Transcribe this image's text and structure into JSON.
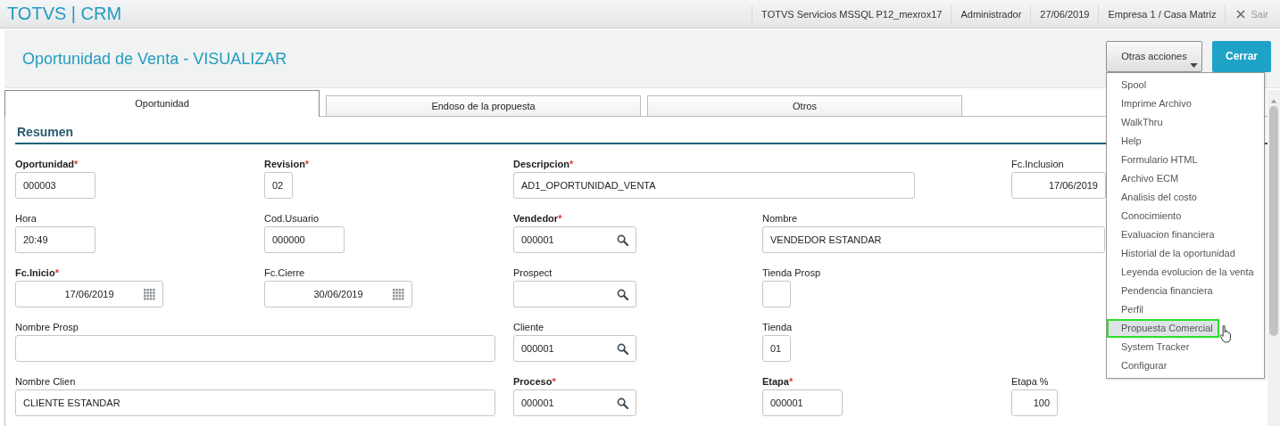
{
  "app": {
    "logo": "TOTVS | CRM",
    "session": [
      "TOTVS Servicios MSSQL P12_mexrox17",
      "Administrador",
      "27/06/2019",
      "Empresa 1 / Casa Matriz"
    ],
    "logout": "Sair"
  },
  "page": {
    "title": "Oportunidad de Venta - VISUALIZAR",
    "actions_button": "Otras acciones",
    "close_button": "Cerrar"
  },
  "tabs": [
    {
      "label": "Oportunidad",
      "selected": true
    },
    {
      "label": "Endoso de la propuesta",
      "selected": false
    },
    {
      "label": "Otros",
      "selected": false
    }
  ],
  "section": {
    "title": "Resumen"
  },
  "form": {
    "rows": [
      [
        {
          "label": "Oportunidad",
          "required": true,
          "mark": "*",
          "value": "000003",
          "kind": "text"
        },
        {
          "label": "Revision",
          "required": true,
          "mark": "*",
          "value": "02",
          "kind": "text"
        },
        {
          "label": "Descripcion",
          "required": true,
          "mark": "*",
          "value": "AD1_OPORTUNIDAD_VENTA",
          "kind": "text"
        },
        {
          "label": "Fc.Inclusion",
          "required": false,
          "value": "17/06/2019",
          "kind": "number"
        }
      ],
      [
        {
          "label": "Hora",
          "required": false,
          "value": "20:49",
          "kind": "text"
        },
        {
          "label": "Cod.Usuario",
          "required": false,
          "value": "000000",
          "kind": "text"
        },
        {
          "label": "Vendedor",
          "required": true,
          "mark": "*",
          "value": "000001",
          "kind": "lookup"
        },
        {
          "label": "Nombre",
          "required": false,
          "value": "VENDEDOR ESTANDAR",
          "kind": "text"
        }
      ],
      [
        {
          "label": "Fc.Inicio",
          "required": true,
          "mark": "*",
          "value": "17/06/2019",
          "kind": "date"
        },
        {
          "label": "Fc.Cierre",
          "required": false,
          "value": "30/06/2019",
          "kind": "date"
        },
        {
          "label": "Prospect",
          "required": false,
          "kind": "lookup"
        },
        {
          "label": "Tienda Prosp",
          "required": false,
          "kind": "text"
        }
      ],
      [
        {
          "label": "Nombre Prosp",
          "required": false,
          "kind": "text"
        },
        {
          "label": "Cliente",
          "required": false,
          "value": "000001",
          "kind": "lookup"
        },
        {
          "label": "Tienda",
          "required": false,
          "value": "01",
          "kind": "text"
        }
      ],
      [
        {
          "label": "Nombre Clien",
          "required": false,
          "value": "CLIENTE ESTANDAR",
          "kind": "text"
        },
        {
          "label": "Proceso",
          "required": true,
          "mark": "*",
          "value": "000001",
          "kind": "lookup"
        },
        {
          "label": "Etapa",
          "required": true,
          "mark": "*",
          "value": "000001",
          "kind": "text"
        },
        {
          "label": "Etapa %",
          "required": false,
          "value": "100",
          "kind": "number"
        }
      ]
    ]
  },
  "actions_menu": {
    "items": [
      {
        "label": "Spool",
        "selected": false
      },
      {
        "label": "Imprime Archivo",
        "selected": false
      },
      {
        "label": "WalkThru",
        "selected": false
      },
      {
        "label": "Help",
        "selected": false
      },
      {
        "label": "Formulario HTML",
        "selected": false
      },
      {
        "label": "Archivo ECM",
        "selected": false
      },
      {
        "label": "Analisis del costo",
        "selected": false
      },
      {
        "label": "Conocimiento",
        "selected": false
      },
      {
        "label": "Evaluacion financiera",
        "selected": false
      },
      {
        "label": "Historial de la oportunidad",
        "selected": false
      },
      {
        "label": "Leyenda evolucion de la venta",
        "selected": false
      },
      {
        "label": "Pendencia financiera",
        "selected": false
      },
      {
        "label": "Perfil",
        "selected": false
      },
      {
        "label": "Propuesta Comercial",
        "selected": true
      },
      {
        "label": "System Tracker",
        "selected": false
      },
      {
        "label": "Configurar",
        "selected": false
      }
    ]
  }
}
